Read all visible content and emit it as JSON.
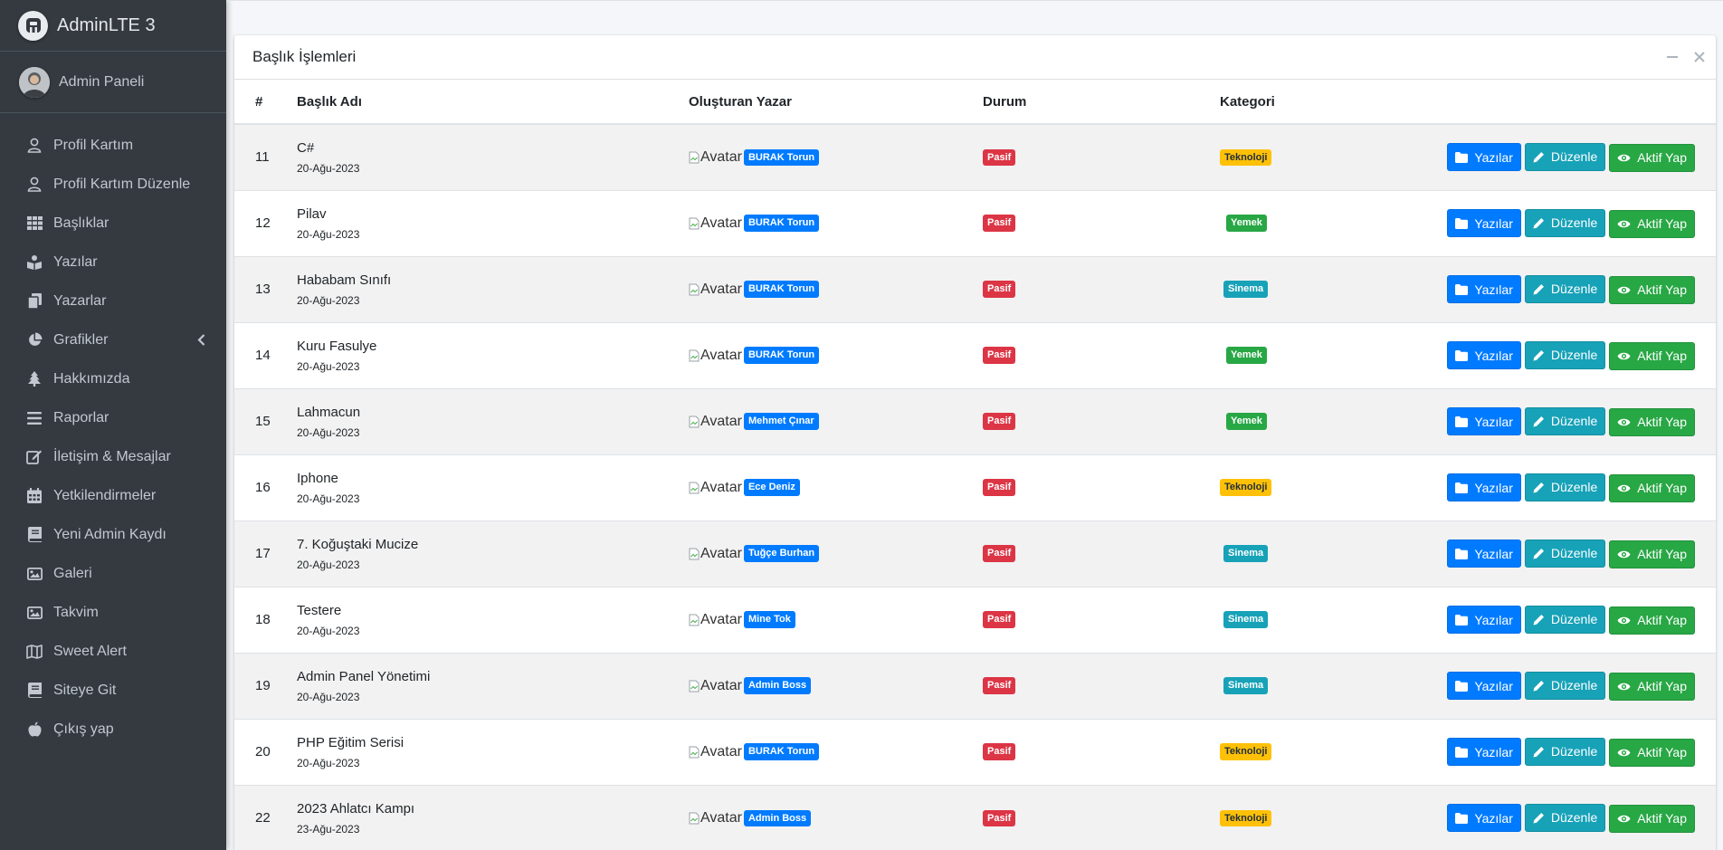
{
  "brand": {
    "name": "AdminLTE 3",
    "logo_icon": "adminlte-logo-icon"
  },
  "user": {
    "name": "Admin Paneli",
    "avatar_icon": "user-avatar"
  },
  "sidebar": {
    "items": [
      {
        "label": "Profil Kartım",
        "icon": "user-icon"
      },
      {
        "label": "Profil Kartım Düzenle",
        "icon": "user-icon"
      },
      {
        "label": "Başlıklar",
        "icon": "grid-icon"
      },
      {
        "label": "Yazılar",
        "icon": "book-reader-icon"
      },
      {
        "label": "Yazarlar",
        "icon": "copy-icon"
      },
      {
        "label": "Grafikler",
        "icon": "pie-chart-icon",
        "caret": "chevron-left-icon"
      },
      {
        "label": "Hakkımızda",
        "icon": "tree-icon"
      },
      {
        "label": "Raporlar",
        "icon": "bars-icon"
      },
      {
        "label": "İletişim & Mesajlar",
        "icon": "edit-icon"
      },
      {
        "label": "Yetkilendirmeler",
        "icon": "calendar-icon"
      },
      {
        "label": "Yeni Admin Kaydı",
        "icon": "book-icon"
      },
      {
        "label": "Galeri",
        "icon": "image-icon"
      },
      {
        "label": "Takvim",
        "icon": "image-icon"
      },
      {
        "label": "Sweet Alert",
        "icon": "map-icon"
      },
      {
        "label": "Siteye Git",
        "icon": "book-icon"
      },
      {
        "label": "Çıkış yap",
        "icon": "apple-icon"
      }
    ]
  },
  "card": {
    "title": "Başlık İşlemleri",
    "minimize_icon": "minus-icon",
    "close_icon": "times-icon"
  },
  "table": {
    "headers": [
      "#",
      "Başlık Adı",
      "Oluşturan Yazar",
      "Durum",
      "Kategori"
    ],
    "avatar_alt": "Avatar",
    "buttons": {
      "posts": "Yazılar",
      "edit": "Düzenle",
      "activate": "Aktif Yap"
    },
    "button_icons": {
      "posts": "folder-icon",
      "edit": "pencil-icon",
      "activate": "eye-icon"
    },
    "rows": [
      {
        "id": "11",
        "title": "C#",
        "date": "20-Ağu-2023",
        "author": "BURAK Torun",
        "status": "Pasif",
        "category": "Teknoloji"
      },
      {
        "id": "12",
        "title": "Pilav",
        "date": "20-Ağu-2023",
        "author": "BURAK Torun",
        "status": "Pasif",
        "category": "Yemek"
      },
      {
        "id": "13",
        "title": "Hababam Sınıfı",
        "date": "20-Ağu-2023",
        "author": "BURAK Torun",
        "status": "Pasif",
        "category": "Sinema"
      },
      {
        "id": "14",
        "title": "Kuru Fasulye",
        "date": "20-Ağu-2023",
        "author": "BURAK Torun",
        "status": "Pasif",
        "category": "Yemek"
      },
      {
        "id": "15",
        "title": "Lahmacun",
        "date": "20-Ağu-2023",
        "author": "Mehmet Çınar",
        "status": "Pasif",
        "category": "Yemek"
      },
      {
        "id": "16",
        "title": "Iphone",
        "date": "20-Ağu-2023",
        "author": "Ece Deniz",
        "status": "Pasif",
        "category": "Teknoloji"
      },
      {
        "id": "17",
        "title": "7. Koğuştaki Mucize",
        "date": "20-Ağu-2023",
        "author": "Tuğçe Burhan",
        "status": "Pasif",
        "category": "Sinema"
      },
      {
        "id": "18",
        "title": "Testere",
        "date": "20-Ağu-2023",
        "author": "Mine Tok",
        "status": "Pasif",
        "category": "Sinema"
      },
      {
        "id": "19",
        "title": "Admin Panel Yönetimi",
        "date": "20-Ağu-2023",
        "author": "Admin Boss",
        "status": "Pasif",
        "category": "Sinema"
      },
      {
        "id": "20",
        "title": "PHP Eğitim Serisi",
        "date": "20-Ağu-2023",
        "author": "BURAK Torun",
        "status": "Pasif",
        "category": "Teknoloji"
      },
      {
        "id": "22",
        "title": "2023 Ahlatcı Kampı",
        "date": "23-Ağu-2023",
        "author": "Admin Boss",
        "status": "Pasif",
        "category": "Teknoloji"
      }
    ]
  },
  "colors": {
    "sidebar_bg": "#343a40",
    "primary": "#007bff",
    "info": "#17a2b8",
    "success": "#28a745",
    "danger": "#dc3545",
    "warning": "#ffc107"
  }
}
